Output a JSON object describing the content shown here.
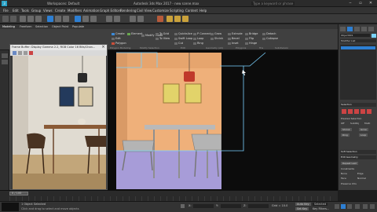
{
  "app": {
    "title": "Autodesk 3ds Max 2017 - new scene.max",
    "workspace_label": "Workspaces: Default",
    "search_placeholder": "Type a keyword or phrase"
  },
  "menu": [
    "File",
    "Edit",
    "Tools",
    "Group",
    "Views",
    "Create",
    "Modifiers",
    "Animation",
    "Graph Editors",
    "Rendering",
    "Civil View",
    "Customize",
    "Scripting",
    "Content",
    "Help"
  ],
  "ribbon": {
    "tabs": [
      "Modeling",
      "Freeform",
      "Selection",
      "Object Paint",
      "Populate"
    ],
    "tools": [
      {
        "label": "Create"
      },
      {
        "label": "Edit"
      },
      {
        "label": "Polygon"
      },
      {
        "label": "Element"
      },
      {
        "label": "Modify Mode"
      },
      {
        "label": "To Grid"
      },
      {
        "label": "To View"
      },
      {
        "label": "Quickslice"
      },
      {
        "label": "Swift Loop"
      },
      {
        "label": "Cut"
      },
      {
        "label": "P Connect"
      },
      {
        "label": "Loop"
      },
      {
        "label": "Ring"
      },
      {
        "label": "Grow"
      },
      {
        "label": "Shrink"
      },
      {
        "label": "Extrude"
      },
      {
        "label": "Bevel"
      },
      {
        "label": "Inset"
      },
      {
        "label": "Bridge"
      },
      {
        "label": "Flip"
      },
      {
        "label": "Hinge"
      },
      {
        "label": "Detach"
      },
      {
        "label": "Collapse"
      }
    ],
    "sections": [
      "Polygon Modeling",
      "Modify Selection",
      "Edit",
      "Geometry (All)",
      "Polygons",
      "Tris",
      "Subdivision"
    ]
  },
  "framebuffer": {
    "title": "Frame Buffer: Display Gamma 2.2, RGB Color 16 Bits/Chan..."
  },
  "command_panel": {
    "object_name": "Object001",
    "selection_label": "Selection",
    "soft_selection_label": "Soft Selection",
    "edit_geometry_label": "Edit Geometry",
    "modifier_list": "Modifier List",
    "preview_selection": "Preview Selection",
    "off_label": "Off",
    "subobj_label": "SubObj",
    "multi_label": "Multi",
    "shrink_label": "Shrink",
    "grow_label": "Grow",
    "ring_label": "Ring",
    "loop_label": "Loop",
    "repeat_last": "Repeat Last",
    "constraints": "Constraints",
    "none_label": "None",
    "edge_label": "Edge",
    "face_label": "Face",
    "normal_label": "Normal",
    "preserve_uvs": "Preserve UVs"
  },
  "status": {
    "objects_selected": "1 Object Selected",
    "prompt": "Click and drag to select and move objects",
    "frame_display": "0 / 100",
    "x_label": "X:",
    "y_label": "Y:",
    "z_label": "Z:",
    "grid_label": "Grid = 10.0",
    "auto_key": "Auto Key",
    "set_key": "Set Key",
    "selected_label": "Selected",
    "key_filters": "Key Filters...",
    "add_time_tag": "Add Time Tag"
  },
  "colors": {
    "accent_blue": "#2d7fd3",
    "selection_cyan": "#7ad2ff",
    "wall_peach": "#f0b27d",
    "floor_lavender": "#a59ad8",
    "pendant_red": "#c0392b",
    "panel_dark": "#3c3c3c"
  }
}
